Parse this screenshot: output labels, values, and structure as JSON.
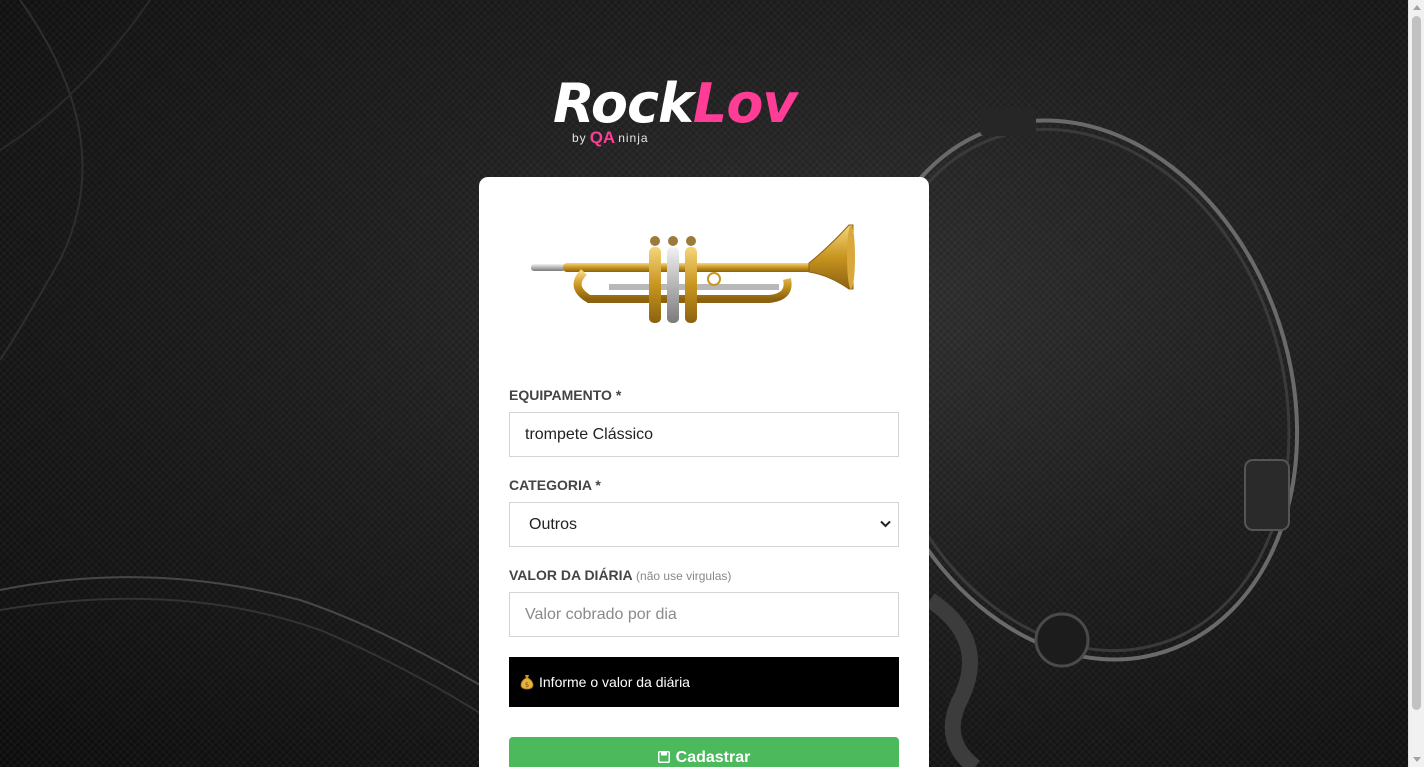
{
  "brand": {
    "name_part1": "Rock",
    "name_part2": "Lov",
    "by": "by",
    "qa": "QA",
    "ninja": "ninja",
    "colors": {
      "accent": "#ff3d96",
      "button": "#4bb95c"
    }
  },
  "form": {
    "equipment": {
      "label": "EQUIPAMENTO *",
      "value": "trompete Clássico"
    },
    "category": {
      "label": "CATEGORIA *",
      "selected": "Outros"
    },
    "price": {
      "label": "VALOR DA DIÁRIA",
      "hint": "(não use virgulas)",
      "placeholder": "Valor cobrado por dia",
      "value": ""
    },
    "alert": {
      "icon": "money-bag-icon",
      "message": "Informe o valor da diária"
    },
    "submit": {
      "icon": "save-icon",
      "label": "Cadastrar"
    }
  }
}
